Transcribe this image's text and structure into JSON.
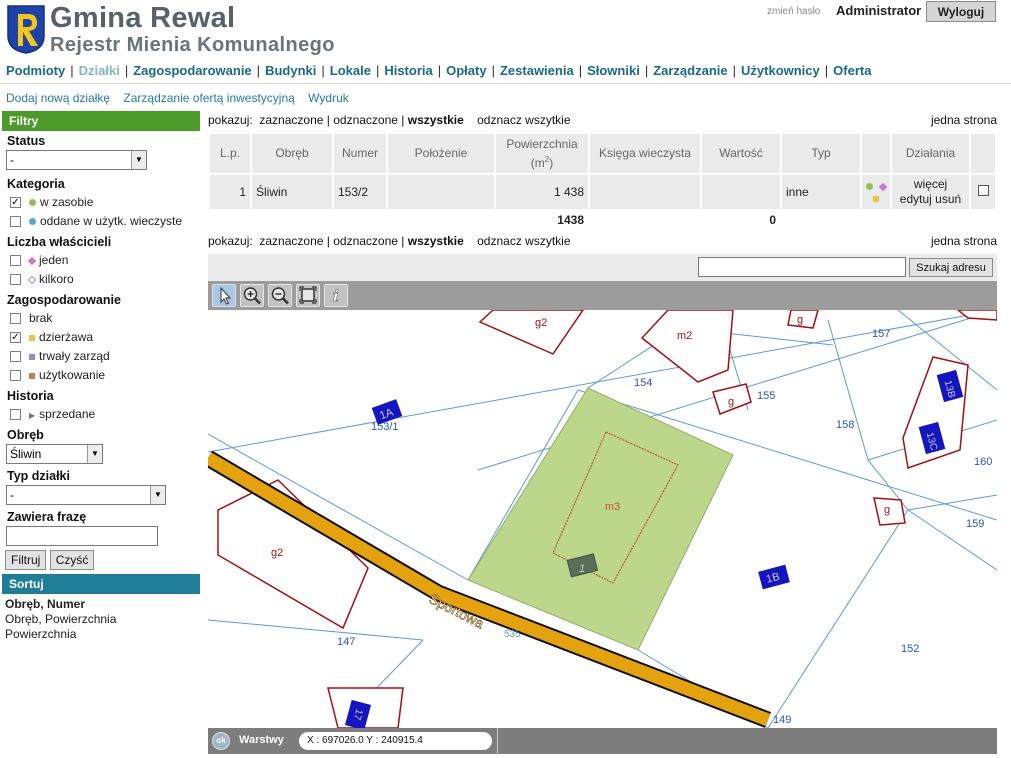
{
  "header": {
    "title": "Gmina Rewal",
    "subtitle": "Rejestr Mienia Komunalnego",
    "change_password": "zmień hasło",
    "user": "Administrator",
    "logout": "Wyloguj"
  },
  "nav": {
    "items": [
      "Podmioty",
      "Działki",
      "Zagospodarowanie",
      "Budynki",
      "Lokale",
      "Historia",
      "Opłaty",
      "Zestawienia",
      "Słowniki",
      "Zarządzanie",
      "Użytkownicy",
      "Oferta"
    ],
    "active": "Działki",
    "separator": "|"
  },
  "subnav": {
    "add_parcel": "Dodaj nową działkę",
    "investment_offer": "Zarządzanie ofertą inwestycyjną",
    "print": "Wydruk"
  },
  "sidebar": {
    "filters_title": "Filtry",
    "status_label": "Status",
    "status_value": "-",
    "category_label": "Kategoria",
    "category_items": [
      "w zasobie",
      "oddane w użytk. wieczyste"
    ],
    "owners_label": "Liczba właścicieli",
    "owners_items": [
      "jeden",
      "kilkoro"
    ],
    "development_label": "Zagospodarowanie",
    "development_items": [
      "brak",
      "dzierżawa",
      "trwały zarząd",
      "użytkowanie"
    ],
    "history_label": "Historia",
    "history_items": [
      "sprzedane"
    ],
    "district_label": "Obręb",
    "district_value": "Śliwin",
    "parcel_type_label": "Typ działki",
    "parcel_type_value": "-",
    "phrase_label": "Zawiera frazę",
    "phrase_value": "",
    "filter_button": "Filtruj",
    "clear_button": "Czyść",
    "sort_title": "Sortuj",
    "sort_items": [
      "Obręb, Numer",
      "Obręb, Powierzchnia",
      "Powierzchnia"
    ],
    "colors": {
      "w_zasobie": "#8dc05a",
      "oddane": "#5aa6c8",
      "jeden": "#c87ac8",
      "kilkoro": "#c87ac8",
      "dzierzawa": "#f0c050",
      "trwaly_zarzad": "#9090c8",
      "uzytkowanie": "#c08050"
    }
  },
  "list": {
    "show_label": "pokazuj:",
    "show_selected": "zaznaczone",
    "show_unselected": "odznaczone",
    "show_all": "wszystkie",
    "unmark_all": "odznacz wszytkie",
    "paging": "jedna strona",
    "columns": {
      "lp": "L.p.",
      "obreb": "Obręb",
      "numer": "Numer",
      "polozenie": "Położenie",
      "powierzchnia": "Powierzchnia",
      "powierzchnia_unit": "(m",
      "powierzchnia_unit_close": ")",
      "ksiega": "Księga wieczysta",
      "wartosc": "Wartość",
      "typ": "Typ",
      "dzialania": "Działania"
    },
    "rows": [
      {
        "lp": "1",
        "obreb": "Śliwin",
        "numer": "153/2",
        "polozenie": "",
        "powierzchnia": "1 438",
        "ksiega": "",
        "wartosc": "",
        "typ": "inne",
        "action_more": "więcej",
        "action_edit": "edytuj",
        "action_delete": "usuń"
      }
    ],
    "totals": {
      "powierzchnia": "1438",
      "wartosc": "0"
    }
  },
  "map": {
    "search_placeholder": "",
    "search_button": "Szukaj adresu",
    "tools": [
      "select-tool",
      "zoom-in-tool",
      "zoom-out-tool",
      "full-extent-tool",
      "info-tool"
    ],
    "parcel_labels": [
      "157",
      "154",
      "155",
      "158",
      "160",
      "159",
      "147",
      "152",
      "149",
      "153/1"
    ],
    "buildings": [
      "g2",
      "m2",
      "g",
      "g",
      "g",
      "m3",
      "g2",
      "1",
      "1A",
      "1B",
      "13B",
      "13C",
      "17"
    ],
    "street_name": "Sportowa",
    "street_code": "535",
    "status_ok": "ok",
    "layers_label": "Warstwy",
    "coords": "X : 697026.0  Y : 240915.4",
    "colors": {
      "parcel_line": "#5b9bd5",
      "building_line": "#a41010",
      "highlight_fill": "#bcd78b",
      "street": "#e4a20f",
      "label_blue": "#1515c0"
    }
  }
}
